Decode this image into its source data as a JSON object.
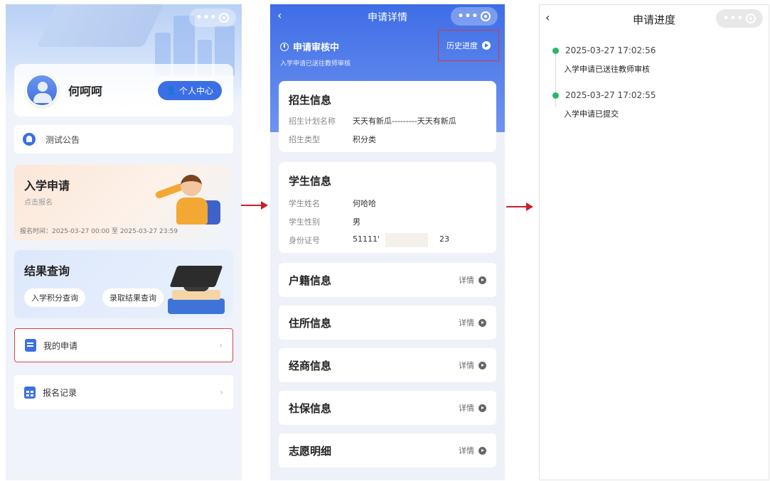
{
  "colors": {
    "primary": "#3b6fe6",
    "success": "#29b765",
    "highlight": "#d43a3a"
  },
  "screen1": {
    "user_name": "何呵呵",
    "personal_center": "个人中心",
    "notice": "测试公告",
    "enroll": {
      "title": "入学申请",
      "subtitle": "点击报名",
      "time": "报名时间：2025-03-27 00:00 至 2025-03-27 23:59"
    },
    "result": {
      "title": "结果查询",
      "btn_score": "入学积分查询",
      "btn_admission": "录取结果查询"
    },
    "menu": {
      "my_application": "我的申请",
      "signup_record": "报名记录",
      "chevron": "›"
    }
  },
  "screen2": {
    "back": "‹",
    "title": "申请详情",
    "status_title": "申请审核中",
    "status_sub": "入学申请已送往教师审核",
    "history": "历史进度",
    "admission_info": {
      "title": "招生信息",
      "rows": [
        {
          "k": "招生计划名称",
          "v": "天天有新瓜---------天天有新瓜"
        },
        {
          "k": "招生类型",
          "v": "积分类"
        }
      ]
    },
    "student_info": {
      "title": "学生信息",
      "rows": [
        {
          "k": "学生姓名",
          "v": "何哈哈"
        },
        {
          "k": "学生性别",
          "v": "男"
        },
        {
          "k": "身份证号",
          "v": "51111'"
        }
      ],
      "id_suffix": "23"
    },
    "detail_label": "详情",
    "sections": [
      "户籍信息",
      "住所信息",
      "经商信息",
      "社保信息",
      "志愿明细"
    ]
  },
  "screen3": {
    "back": "‹",
    "title": "申请进度",
    "timeline": [
      {
        "time": "2025-03-27 17:02:56",
        "text": "入学申请已送往教师审核"
      },
      {
        "time": "2025-03-27 17:02:55",
        "text": "入学申请已提交"
      }
    ]
  }
}
